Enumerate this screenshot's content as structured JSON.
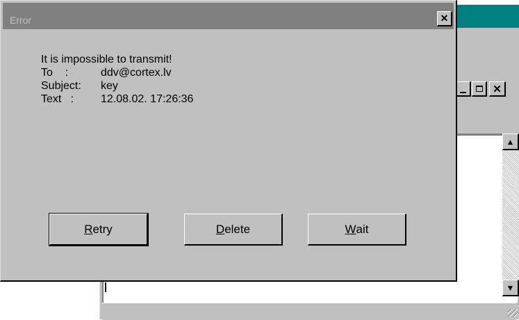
{
  "background_window": {
    "minimize_icon": "minimize-icon",
    "maximize_icon": "maximize-icon",
    "close_icon": "close-icon",
    "scroll_up_icon": "scroll-up-icon",
    "scroll_down_icon": "scroll-down-icon"
  },
  "dialog": {
    "title": "Error",
    "close_icon": "close-icon",
    "message": {
      "line1": "It is impossible to transmit!",
      "to_label": "To    :",
      "to_value": "ddv@cortex.lv",
      "subject_label": "Subject:",
      "subject_value": "key",
      "text_label": "Text   :",
      "text_value": "12.08.02. 17:26:36"
    },
    "buttons": {
      "retry_mnemonic": "R",
      "retry_rest": "etry",
      "delete_mnemonic": "D",
      "delete_rest": "elete",
      "wait_mnemonic": "W",
      "wait_rest": "ait"
    }
  }
}
